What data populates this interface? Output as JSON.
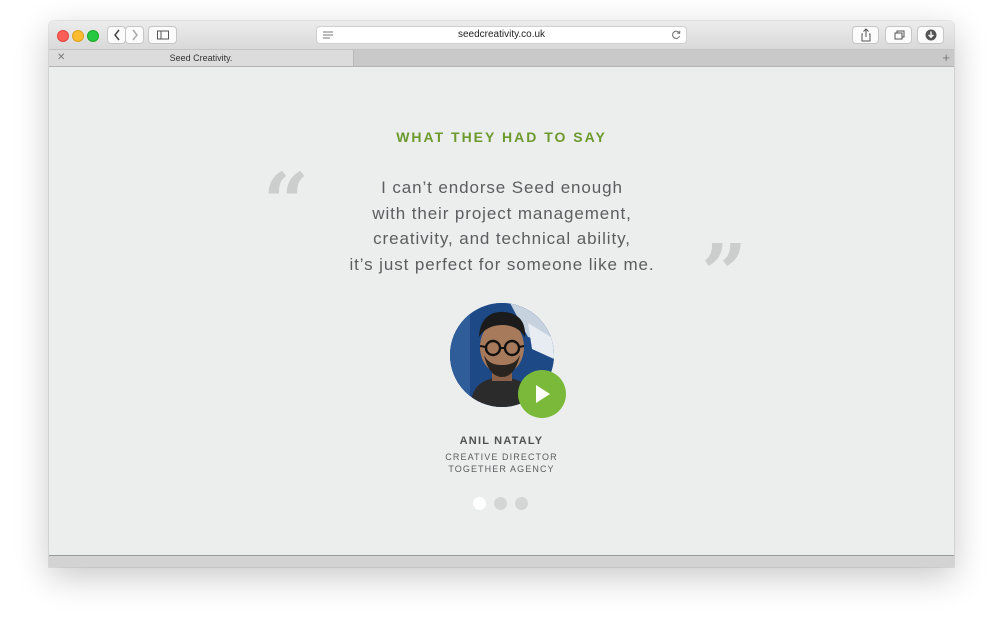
{
  "browser": {
    "url": "seedcreativity.co.uk",
    "tab_title": "Seed Creativity.",
    "tab_close_glyph": "✕",
    "new_tab_glyph": "+"
  },
  "section": {
    "heading": "WHAT THEY HAD TO SAY",
    "open_quote_glyph": "“",
    "close_quote_glyph": "”",
    "quote_lines": [
      "I can’t endorse Seed enough",
      "with their project management,",
      "creativity, and technical ability,",
      "it’s just perfect for someone like me."
    ]
  },
  "testimonial": {
    "name": "ANIL NATALY",
    "role": "CREATIVE DIRECTOR",
    "agency": "TOGETHER AGENCY"
  },
  "carousel": {
    "count": 3,
    "active_index": 0
  },
  "colors": {
    "accent_green": "#6c9a2c",
    "play_green": "#7ab939",
    "text_gray": "#5b5d5e",
    "background": "#eceeee"
  },
  "icons": [
    "back-arrow-icon",
    "forward-arrow-icon",
    "sidebar-icon",
    "reader-icon",
    "reload-icon",
    "share-icon",
    "tabs-icon",
    "download-icon",
    "play-icon",
    "quote-open-icon",
    "quote-close-icon",
    "close-icon",
    "plus-icon"
  ]
}
